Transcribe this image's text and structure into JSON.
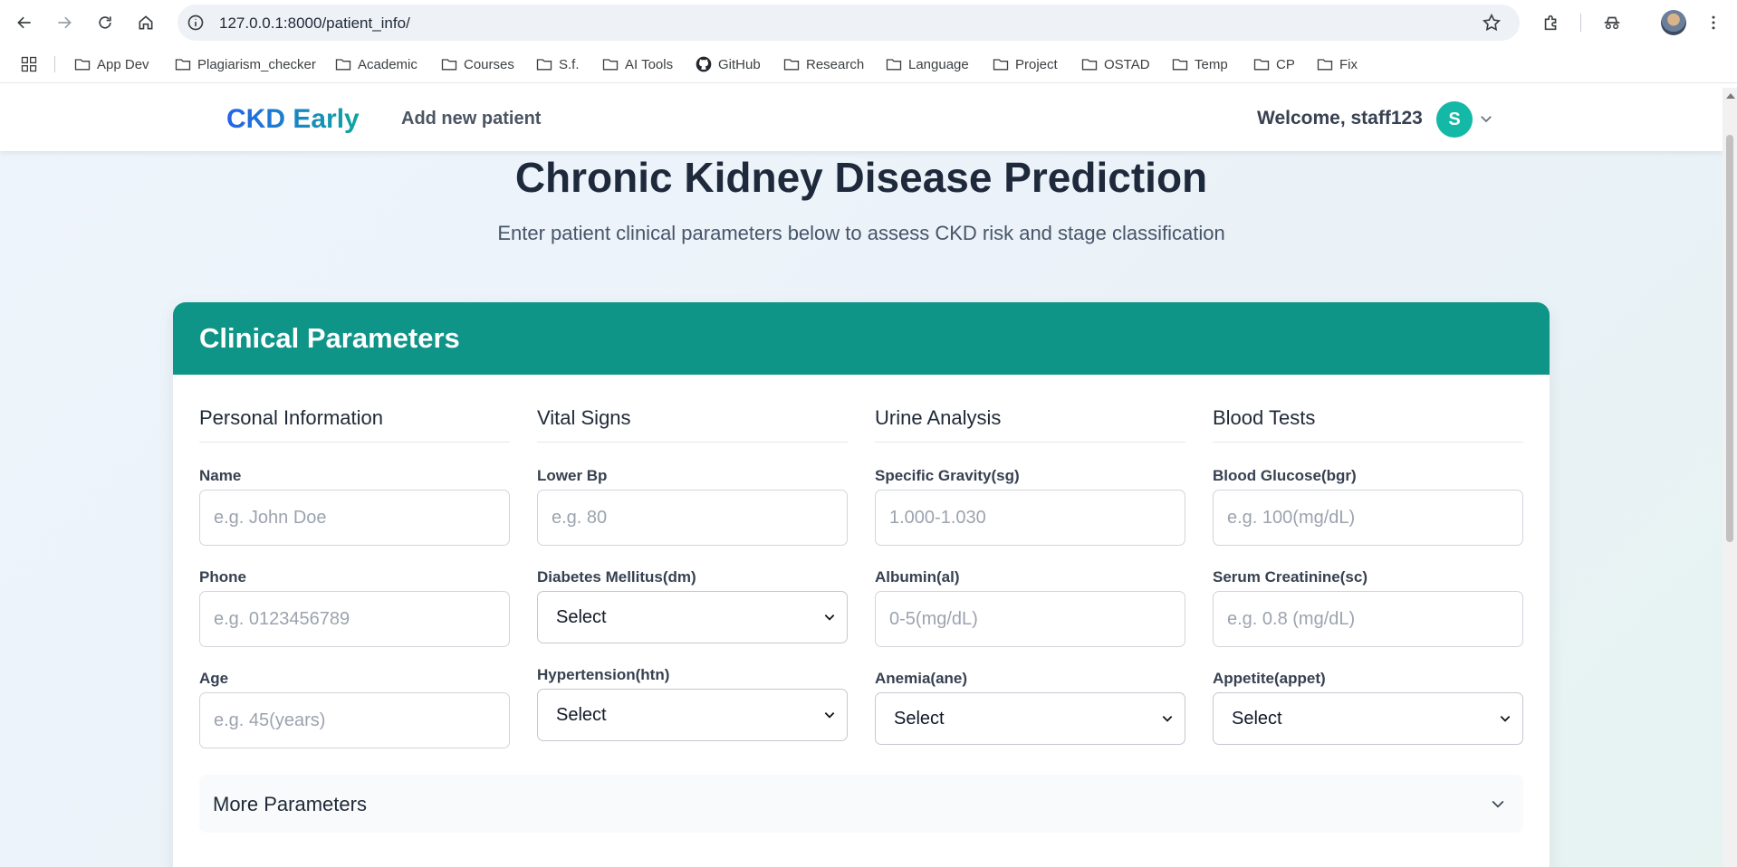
{
  "browser": {
    "url": "127.0.0.1:8000/patient_info/",
    "bookmarks": [
      "App Dev",
      "Plagiarism_checker",
      "Academic",
      "Courses",
      "S.f.",
      "AI Tools",
      "GitHub",
      "Research",
      "Language",
      "Project",
      "OSTAD",
      "Temp",
      "CP",
      "Fix"
    ]
  },
  "app": {
    "brand": "CKD Early",
    "nav_link": "Add new patient",
    "welcome": "Welcome, staff123",
    "user_initial": "S",
    "accent_color": "#0f9488"
  },
  "page": {
    "title": "Chronic Kidney Disease Prediction",
    "subtitle": "Enter patient clinical parameters below to assess CKD risk and stage classification"
  },
  "form": {
    "card_title": "Clinical Parameters",
    "sections": [
      {
        "title": "Personal Information",
        "fields": [
          {
            "label": "Name",
            "type": "input",
            "placeholder": "e.g. John Doe"
          },
          {
            "label": "Phone",
            "type": "input",
            "placeholder": "e.g. 0123456789"
          },
          {
            "label": "Age",
            "type": "input",
            "placeholder": "e.g. 45(years)"
          }
        ]
      },
      {
        "title": "Vital Signs",
        "fields": [
          {
            "label": "Lower Bp",
            "type": "input",
            "placeholder": "e.g. 80"
          },
          {
            "label": "Diabetes Mellitus(dm)",
            "type": "select",
            "value": "Select"
          },
          {
            "label": "Hypertension(htn)",
            "type": "select",
            "value": "Select"
          }
        ]
      },
      {
        "title": "Urine Analysis",
        "fields": [
          {
            "label": "Specific Gravity(sg)",
            "type": "input",
            "placeholder": "1.000-1.030"
          },
          {
            "label": "Albumin(al)",
            "type": "input",
            "placeholder": "0-5(mg/dL)"
          },
          {
            "label": "Anemia(ane)",
            "type": "select",
            "value": "Select"
          }
        ]
      },
      {
        "title": "Blood Tests",
        "fields": [
          {
            "label": "Blood Glucose(bgr)",
            "type": "input",
            "placeholder": "e.g. 100(mg/dL)"
          },
          {
            "label": "Serum Creatinine(sc)",
            "type": "input",
            "placeholder": "e.g. 0.8 (mg/dL)"
          },
          {
            "label": "Appetite(appet)",
            "type": "select",
            "value": "Select"
          }
        ]
      }
    ],
    "more_label": "More Parameters"
  }
}
